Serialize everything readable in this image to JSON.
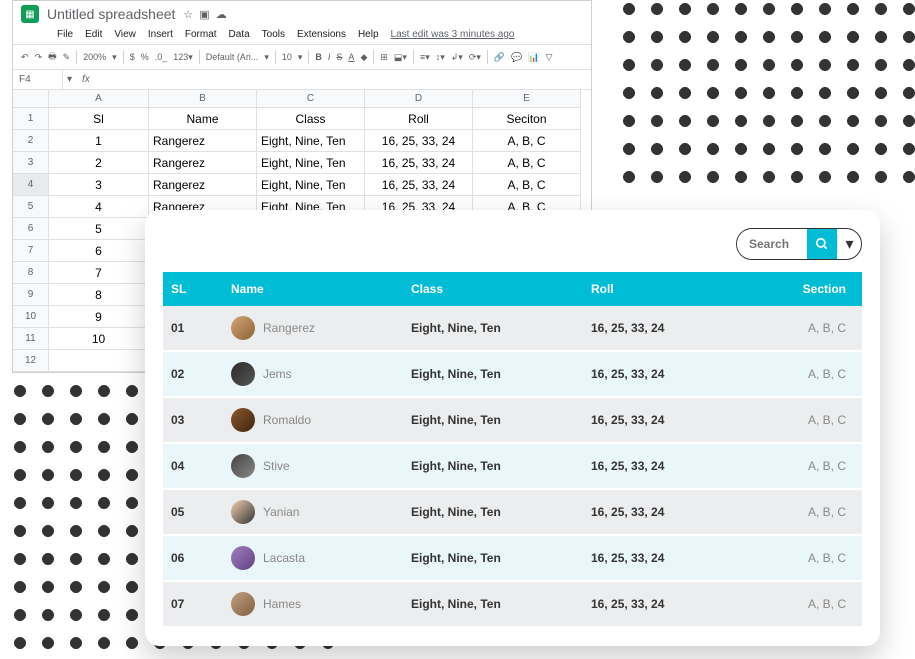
{
  "sheets": {
    "title": "Untitled spreadsheet",
    "menu": {
      "file": "File",
      "edit": "Edit",
      "view": "View",
      "insert": "Insert",
      "format": "Format",
      "data": "Data",
      "tools": "Tools",
      "extensions": "Extensions",
      "help": "Help"
    },
    "last_edit": "Last edit was 3 minutes ago",
    "toolbar": {
      "zoom": "200%",
      "currency": "$",
      "percent": "%",
      "decimals": ".0_",
      "font": "Default (Ari...",
      "font_size": "10",
      "bold": "B",
      "italic": "I",
      "strike": "S",
      "underline": "A"
    },
    "cell_ref": "F4",
    "fx": "fx",
    "columns": [
      "A",
      "B",
      "C",
      "D",
      "E"
    ],
    "row_numbers": [
      "1",
      "2",
      "3",
      "4",
      "5",
      "6",
      "7",
      "8",
      "9",
      "10",
      "11",
      "12"
    ],
    "headers": {
      "sl": "Sl",
      "name": "Name",
      "class": "Class",
      "roll": "Roll",
      "section": "Seciton"
    },
    "rows": [
      {
        "sl": "1",
        "name": "Rangerez",
        "class": "Eight, Nine, Ten",
        "roll": "16, 25, 33, 24",
        "section": "A, B, C"
      },
      {
        "sl": "2",
        "name": "Rangerez",
        "class": "Eight, Nine, Ten",
        "roll": "16, 25, 33, 24",
        "section": "A, B, C"
      },
      {
        "sl": "3",
        "name": "Rangerez",
        "class": "Eight, Nine, Ten",
        "roll": "16, 25, 33, 24",
        "section": "A, B, C"
      },
      {
        "sl": "4",
        "name": "Rangerez",
        "class": "Eight, Nine, Ten",
        "roll": "16, 25, 33, 24",
        "section": "A, B, C"
      },
      {
        "sl": "5",
        "name": "",
        "class": "",
        "roll": "",
        "section": ""
      },
      {
        "sl": "6",
        "name": "",
        "class": "",
        "roll": "",
        "section": ""
      },
      {
        "sl": "7",
        "name": "",
        "class": "",
        "roll": "",
        "section": ""
      },
      {
        "sl": "8",
        "name": "",
        "class": "",
        "roll": "",
        "section": ""
      },
      {
        "sl": "9",
        "name": "",
        "class": "",
        "roll": "",
        "section": ""
      },
      {
        "sl": "10",
        "name": "",
        "class": "",
        "roll": "",
        "section": ""
      }
    ]
  },
  "table": {
    "search_placeholder": "Search",
    "headers": {
      "sl": "SL",
      "name": "Name",
      "class": "Class",
      "roll": "Roll",
      "section": "Section"
    },
    "rows": [
      {
        "sl": "01",
        "name": "Rangerez",
        "class": "Eight, Nine, Ten",
        "roll": "16, 25, 33, 24",
        "section": "A, B, C"
      },
      {
        "sl": "02",
        "name": "Jems",
        "class": "Eight, Nine, Ten",
        "roll": "16, 25, 33, 24",
        "section": "A, B, C"
      },
      {
        "sl": "03",
        "name": "Romaldo",
        "class": "Eight, Nine, Ten",
        "roll": "16, 25, 33, 24",
        "section": "A, B, C"
      },
      {
        "sl": "04",
        "name": "Stive",
        "class": "Eight, Nine, Ten",
        "roll": "16, 25, 33, 24",
        "section": "A, B, C"
      },
      {
        "sl": "05",
        "name": "Yanian",
        "class": "Eight, Nine, Ten",
        "roll": "16, 25, 33, 24",
        "section": "A, B, C"
      },
      {
        "sl": "06",
        "name": "Lacasta",
        "class": "Eight, Nine, Ten",
        "roll": "16, 25, 33, 24",
        "section": "A, B, C"
      },
      {
        "sl": "07",
        "name": "Hames",
        "class": "Eight, Nine, Ten",
        "roll": "16, 25, 33, 24",
        "section": "A, B, C"
      }
    ]
  }
}
